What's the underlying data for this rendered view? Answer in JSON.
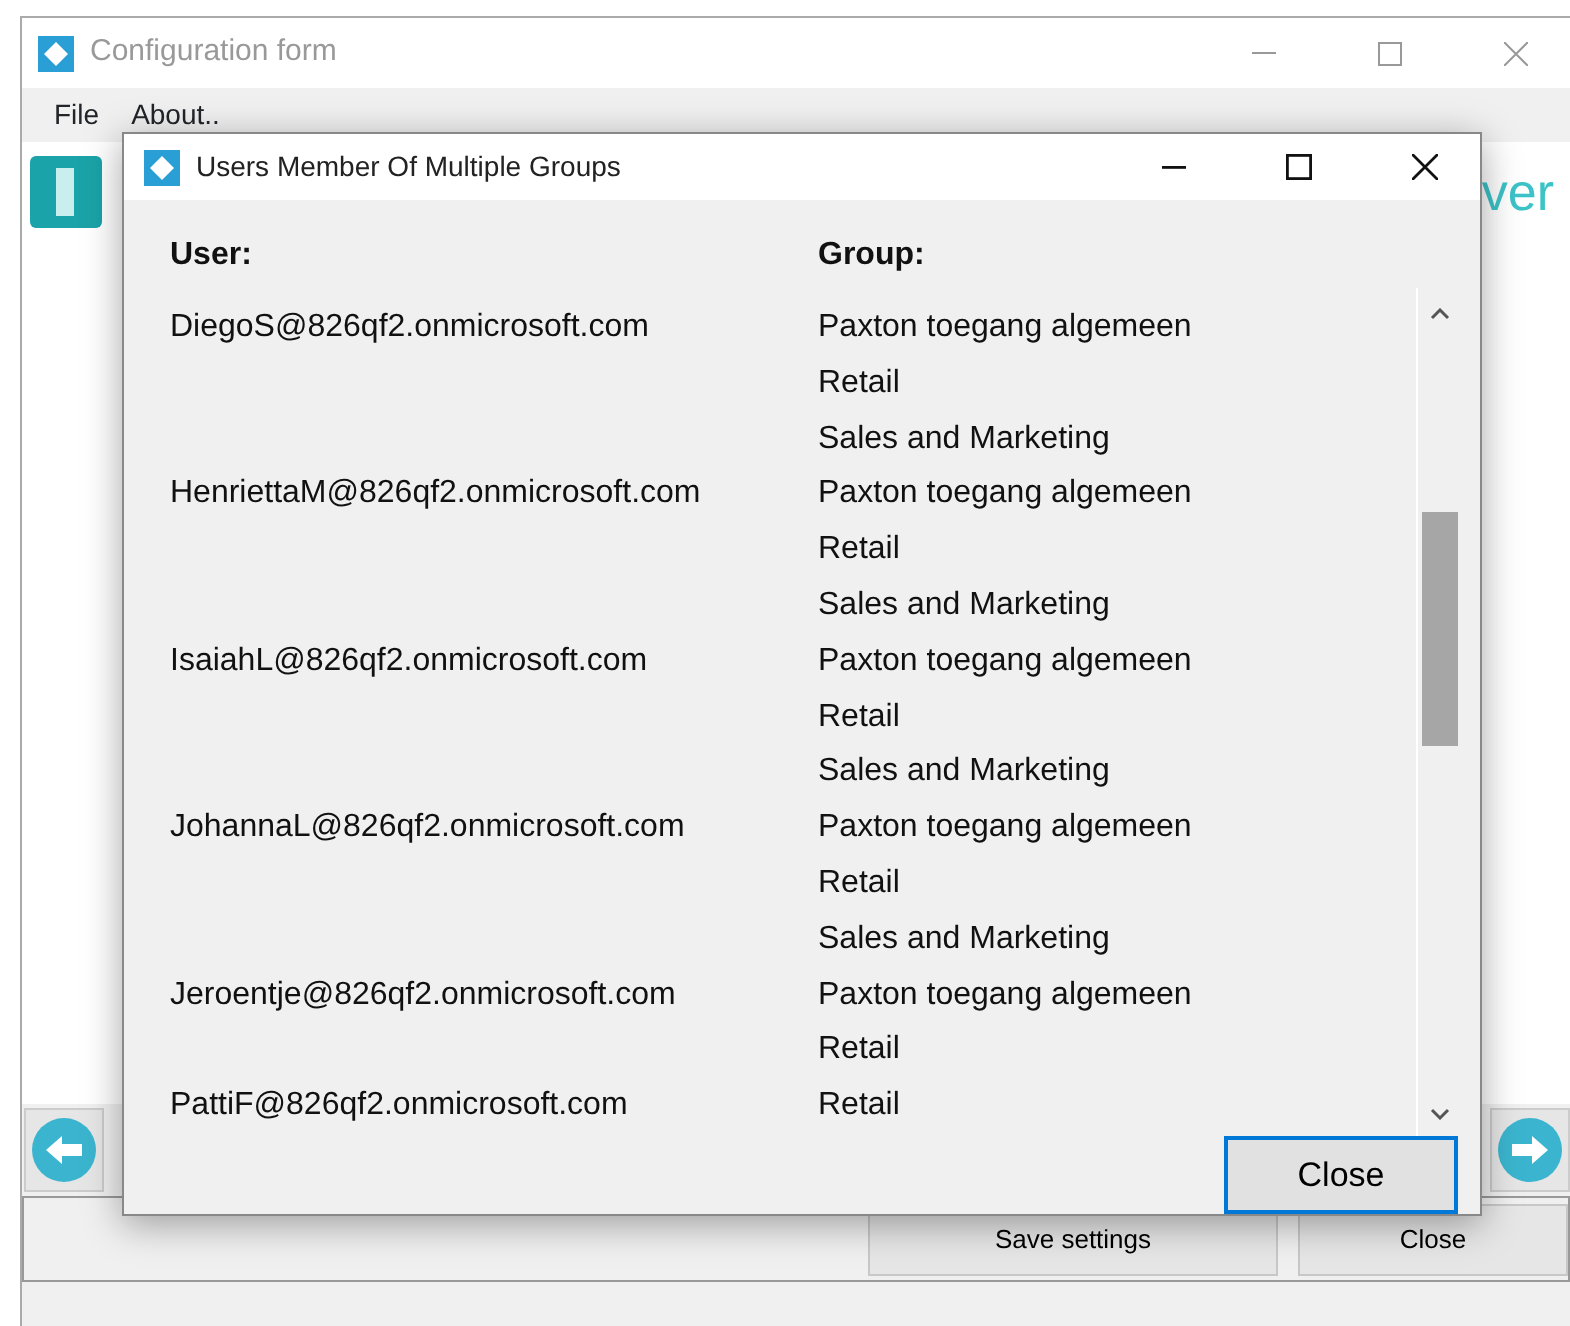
{
  "main_window": {
    "title": "Configuration form",
    "menu": [
      "File",
      "About.."
    ],
    "header_text": "ver",
    "buttons": [
      "Save settings",
      "Close"
    ]
  },
  "dialog": {
    "title": "Users Member Of Multiple Groups",
    "columns": [
      "User:",
      "Group:"
    ],
    "entries": [
      {
        "user": "DiegoS@826qf2.onmicrosoft.com",
        "groups": [
          "Paxton toegang algemeen",
          "Retail",
          "Sales and Marketing"
        ]
      },
      {
        "user": "HenriettaM@826qf2.onmicrosoft.com",
        "groups": [
          "Paxton toegang algemeen",
          "Retail",
          "Sales and Marketing"
        ]
      },
      {
        "user": "IsaiahL@826qf2.onmicrosoft.com",
        "groups": [
          "Paxton toegang algemeen",
          "Retail",
          "Sales and Marketing"
        ]
      },
      {
        "user": "JohannaL@826qf2.onmicrosoft.com",
        "groups": [
          "Paxton toegang algemeen",
          "Retail",
          "Sales and Marketing"
        ]
      },
      {
        "user": "Jeroentje@826qf2.onmicrosoft.com",
        "groups": [
          "Paxton toegang algemeen",
          "Retail"
        ]
      },
      {
        "user": "PattiF@826qf2.onmicrosoft.com",
        "groups": [
          "Retail"
        ]
      }
    ],
    "close_button": "Close"
  }
}
